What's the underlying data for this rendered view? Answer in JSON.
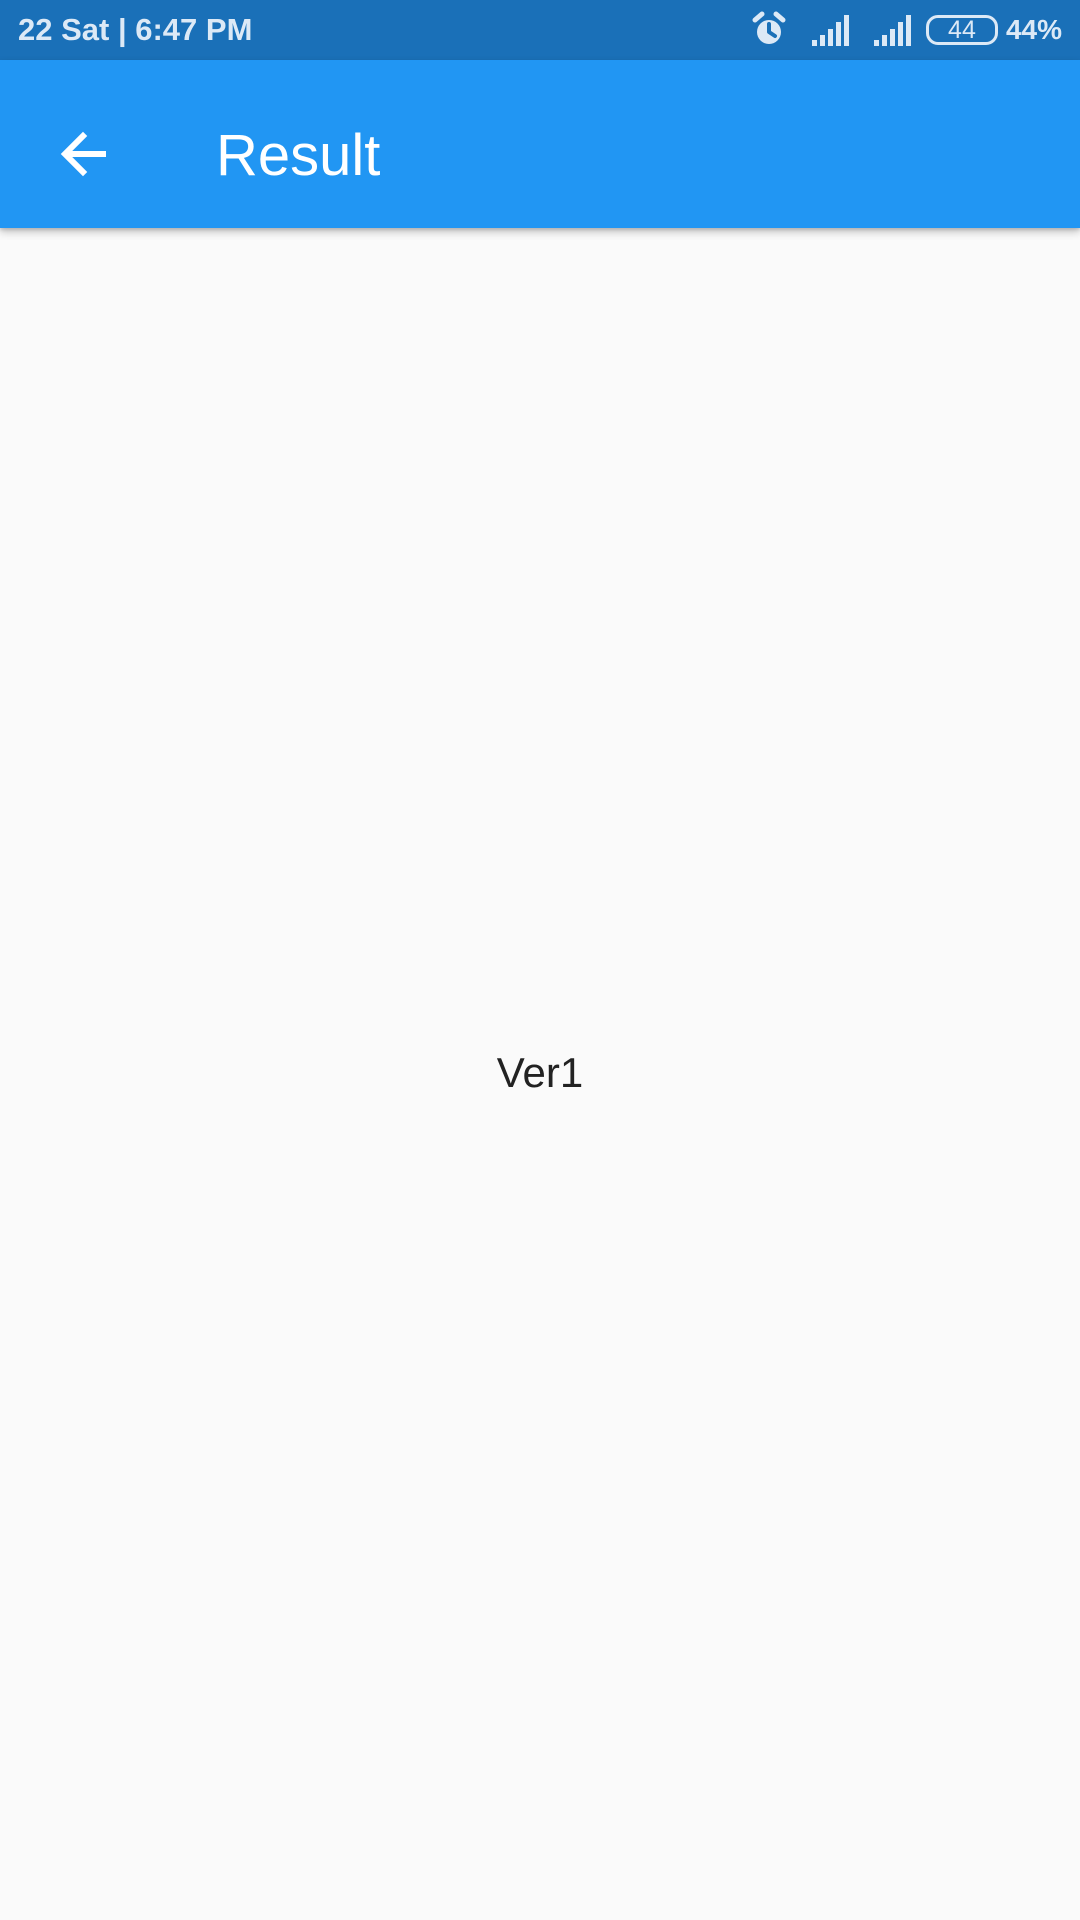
{
  "status_bar": {
    "time_text": "22 Sat | 6:47 PM",
    "battery_level": "44",
    "battery_percent": "44%",
    "icons": [
      "alarm-icon",
      "signal-icon",
      "signal-icon",
      "battery-icon"
    ],
    "background_color": "#1a70b8",
    "foreground_color": "#dce9f6"
  },
  "app_bar": {
    "title": "Result",
    "back_icon": "arrow-left-icon",
    "background_color": "#2196f3",
    "foreground_color": "#ffffff"
  },
  "content": {
    "result_value": "Ver1",
    "background_color": "#fafafa",
    "text_color": "#222222"
  }
}
